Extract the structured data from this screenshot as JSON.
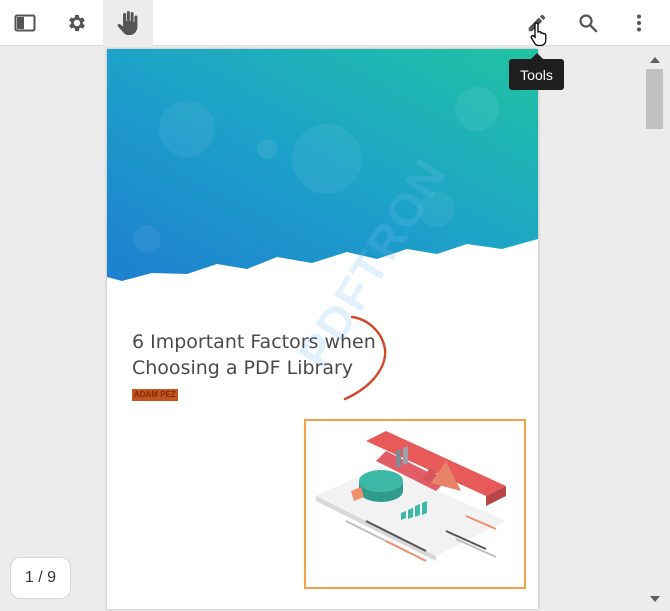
{
  "toolbar": {
    "buttons": [
      {
        "name": "panel-toggle",
        "icon": "sidebar-panel-icon"
      },
      {
        "name": "settings",
        "icon": "gear-icon"
      },
      {
        "name": "pan",
        "icon": "hand-icon",
        "active": true
      },
      {
        "name": "tools",
        "icon": "pencil-icon",
        "tooltip": "Tools"
      },
      {
        "name": "search",
        "icon": "search-icon"
      },
      {
        "name": "more",
        "icon": "vertical-dots-icon"
      }
    ]
  },
  "tooltip": {
    "text": "Tools"
  },
  "document": {
    "title_line1": "6 Important Factors when",
    "title_line2": "Choosing a PDF Library",
    "author": "ADAM PEZ",
    "watermark": "PDFTRON"
  },
  "page_indicator": {
    "text": "1 / 9"
  },
  "colors": {
    "annotation_stroke": "#d2462a",
    "illustration_border": "#f5a04a",
    "hero_teal": "#1fbfa5",
    "hero_blue": "#1d8fd6"
  }
}
